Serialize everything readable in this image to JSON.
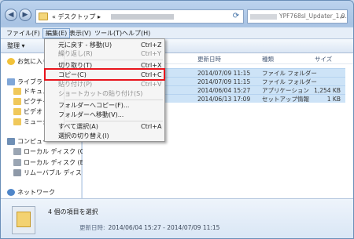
{
  "address": {
    "crumb": "« デスクトップ ▸",
    "search_placeholder": "YPF768sI_Updater_1.0.0.2の検索"
  },
  "menubar": [
    {
      "label": "ファイル(F)"
    },
    {
      "label": "編集(E)"
    },
    {
      "label": "表示(V)"
    },
    {
      "label": "ツール(T)"
    },
    {
      "label": "ヘルプ(H)"
    }
  ],
  "toolbar": {
    "organize": "整理 ▾"
  },
  "sidebar": {
    "favorites": "お気に入り",
    "libraries": "ライブラ",
    "documents": "ドキュメ",
    "pictures": "ピクチャ",
    "videos": "ビデオ",
    "music": "ミュージ",
    "computer": "コンピュー",
    "disk_c": "ローカル ディスク (C:)",
    "disk_e": "ローカル ディスク (E:)",
    "removable": "リムーバブル ディスク (",
    "network": "ネットワーク"
  },
  "columns": {
    "modified": "更新日時",
    "type": "種類",
    "size": "サイズ"
  },
  "files": [
    {
      "modified": "2014/07/09 11:15",
      "type": "ファイル フォルダー",
      "size": ""
    },
    {
      "modified": "2014/07/09 11:15",
      "type": "ファイル フォルダー",
      "size": ""
    },
    {
      "modified": "2014/06/04 15:27",
      "type": "アプリケーション",
      "size": "1,254 KB"
    },
    {
      "modified": "2014/06/13 17:09",
      "type": "セットアップ情報",
      "size": "1 KB"
    }
  ],
  "edit_menu": [
    {
      "label": "元に戻す - 移動(U)",
      "shortcut": "Ctrl+Z",
      "disabled": false
    },
    {
      "label": "繰り返し(R)",
      "shortcut": "Ctrl+Y",
      "disabled": true
    },
    {
      "label": "切り取り(T)",
      "shortcut": "Ctrl+X",
      "disabled": false
    },
    {
      "label": "コピー(C)",
      "shortcut": "Ctrl+C",
      "disabled": false
    },
    {
      "label": "貼り付け(P)",
      "shortcut": "Ctrl+V",
      "disabled": true
    },
    {
      "label": "ショートカットの貼り付け(S)",
      "shortcut": "",
      "disabled": true
    },
    {
      "label": "フォルダーへコピー(F)...",
      "shortcut": "",
      "disabled": false
    },
    {
      "label": "フォルダーへ移動(V)...",
      "shortcut": "",
      "disabled": false
    },
    {
      "label": "すべて選択(A)",
      "shortcut": "Ctrl+A",
      "disabled": false
    },
    {
      "label": "選択の切り替え(I)",
      "shortcut": "",
      "disabled": false
    }
  ],
  "details": {
    "selection": "4 個の項目を選択",
    "date_label": "更新日時:",
    "date_range": "2014/06/04 15:27 - 2014/07/09 11:15"
  },
  "colors": {
    "highlight_box": "#e8141c",
    "selection_row": "#cde3f7"
  }
}
